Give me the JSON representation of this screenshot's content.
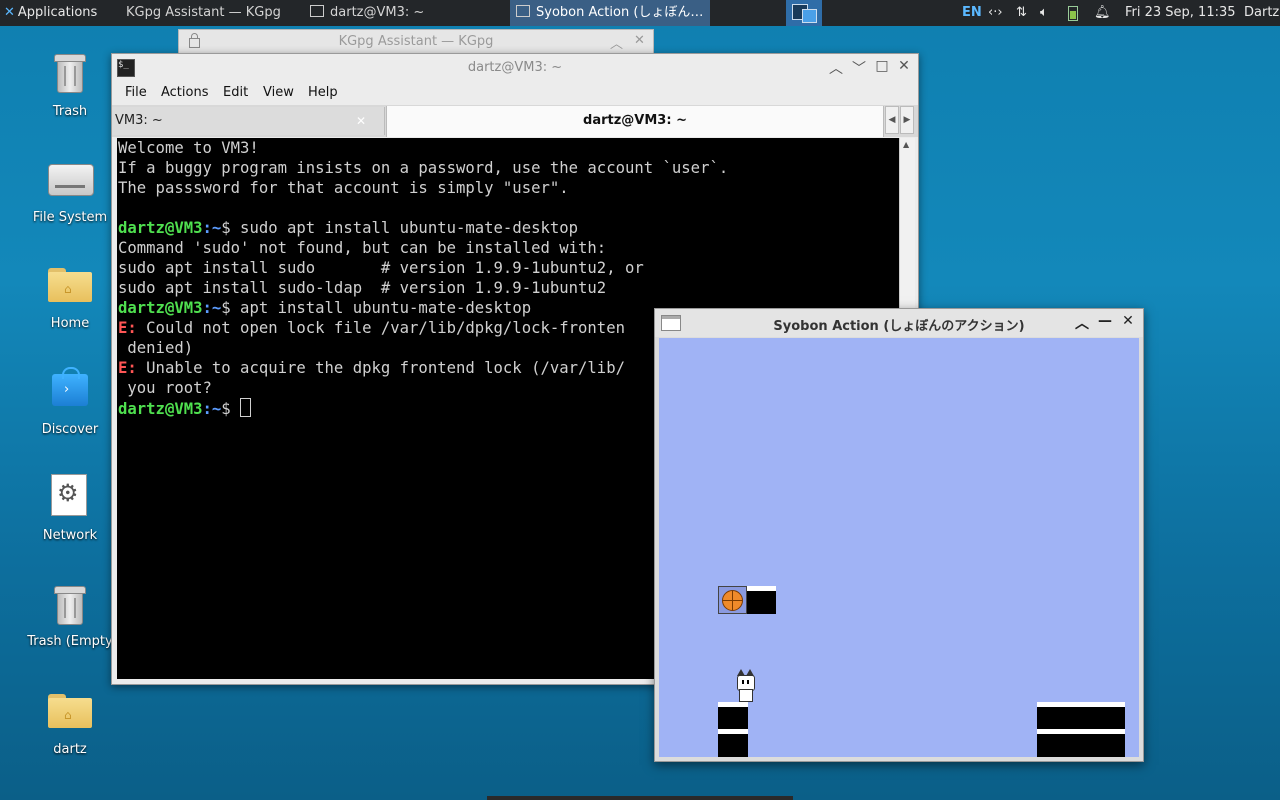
{
  "panel": {
    "applications_label": "Applications",
    "tasks": [
      {
        "label": "KGpg Assistant — KGpg"
      },
      {
        "label": "dartz@VM3: ~"
      },
      {
        "label": "Syobon Action (しょぼん…"
      }
    ],
    "language": "EN",
    "clock": "Fri 23 Sep, 11:35",
    "user": "Dartz",
    "icons": [
      "xfce-menu-icon",
      "network-icon",
      "updown-icon",
      "volume-icon",
      "battery-icon",
      "bell-icon"
    ]
  },
  "desktop": {
    "icons": [
      {
        "label": "Trash",
        "icon": "trash-icon"
      },
      {
        "label": "File System",
        "icon": "drive-icon"
      },
      {
        "label": "Home",
        "icon": "home-folder-icon"
      },
      {
        "label": "Discover",
        "icon": "discover-icon"
      },
      {
        "label": "Network",
        "icon": "gear-icon"
      },
      {
        "label": "Trash (Empty",
        "icon": "trash-icon"
      },
      {
        "label": "dartz",
        "icon": "home-folder-icon"
      }
    ]
  },
  "kgpg_window": {
    "title": "KGpg Assistant — KGpg"
  },
  "terminal": {
    "title": "dartz@VM3: ~",
    "menu": [
      "File",
      "Actions",
      "Edit",
      "View",
      "Help"
    ],
    "tabs": [
      {
        "label": "VM3: ~",
        "active": false
      },
      {
        "label": "dartz@VM3: ~",
        "active": true
      }
    ],
    "prompt_user": "dartz@VM3",
    "prompt_path": ":~",
    "lines": {
      "l1": "Welcome to VM3!",
      "l2": "If a buggy program insists on a password, use the account `user`.",
      "l3": "The passsword for that account is simply \"user\".",
      "cmd1": "$ sudo apt install ubuntu-mate-desktop",
      "l5": "Command 'sudo' not found, but can be installed with:",
      "l6": "sudo apt install sudo       # version 1.9.9-1ubuntu2, or",
      "l7": "sudo apt install sudo-ldap  # version 1.9.9-1ubuntu2",
      "cmd2": "$ apt install ubuntu-mate-desktop",
      "err_prefix": "E:",
      "err1a": " Could not open lock file /var/lib/dpkg/lock-fronten",
      "err1b": " denied)",
      "err2a": " Unable to acquire the dpkg frontend lock (/var/lib/",
      "err2b": " you root?",
      "cmd3": "$ "
    }
  },
  "syobon": {
    "title": "Syobon Action (しょぼんのアクション)",
    "sky_color": "#a0b3f5"
  }
}
